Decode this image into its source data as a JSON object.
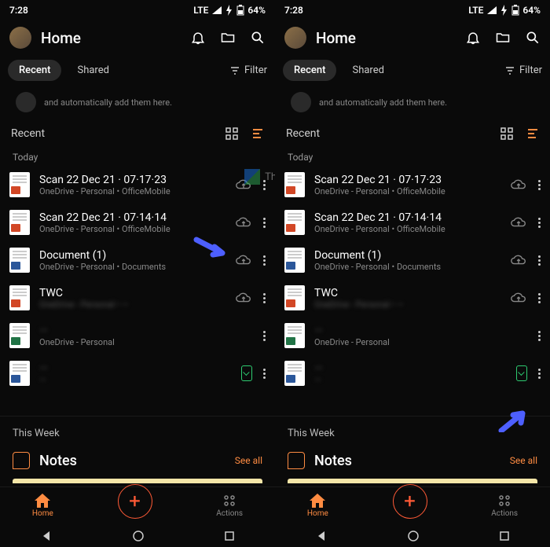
{
  "status": {
    "time": "7:28",
    "net": "LTE",
    "battery": "64%"
  },
  "app_title": "Home",
  "tabs": {
    "recent": "Recent",
    "shared": "Shared",
    "filter": "Filter"
  },
  "banner_text": "and automatically add them here.",
  "section": {
    "recent": "Recent",
    "today": "Today",
    "this_week": "This Week"
  },
  "files": [
    {
      "name": "Scan 22 Dec 21 · 07·17·23",
      "meta": "OneDrive - Personal • OfficeMobile",
      "type": "ppt",
      "cloud": true
    },
    {
      "name": "Scan 22 Dec 21 · 07·14·14",
      "meta": "OneDrive - Personal • OfficeMobile",
      "type": "ppt",
      "cloud": true
    },
    {
      "name": "Document (1)",
      "meta": "OneDrive - Personal • Documents",
      "type": "doc",
      "cloud": true
    },
    {
      "name": "TWC",
      "meta": "OneDrive - Personal • —",
      "type": "ppt",
      "cloud": true
    },
    {
      "name": "—",
      "meta": "OneDrive - Personal",
      "type": "xls",
      "cloud": false
    },
    {
      "name": "—",
      "meta": "—",
      "type": "doc",
      "device": true
    }
  ],
  "notes": {
    "title": "Notes",
    "see_all": "See all"
  },
  "nav": {
    "home": "Home",
    "actions": "Actions"
  },
  "watermark": "TheWir"
}
